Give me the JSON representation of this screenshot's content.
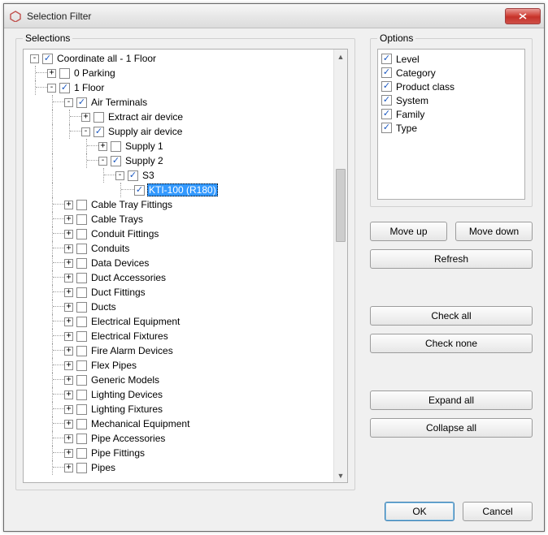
{
  "window": {
    "title": "Selection Filter"
  },
  "selections": {
    "legend": "Selections",
    "tree": {
      "root": {
        "label": "Coordinate all - 1 Floor",
        "checked": true,
        "expand": "-"
      },
      "l0": [
        {
          "label": "0 Parking",
          "checked": false,
          "expand": "+"
        },
        {
          "label": "1 Floor",
          "checked": true,
          "expand": "-"
        }
      ],
      "airterm": {
        "label": "Air Terminals",
        "checked": true,
        "expand": "-"
      },
      "extract": {
        "label": "Extract air device",
        "checked": false,
        "expand": "+"
      },
      "supplydev": {
        "label": "Supply air device",
        "checked": true,
        "expand": "-"
      },
      "supply1": {
        "label": "Supply 1",
        "checked": false,
        "expand": "+"
      },
      "supply2": {
        "label": "Supply 2",
        "checked": true,
        "expand": "-"
      },
      "s3": {
        "label": "S3",
        "checked": true,
        "expand": "-"
      },
      "kti": {
        "label": "KTI-100 (R180)",
        "checked": true
      },
      "siblings": [
        {
          "label": "Cable Tray Fittings",
          "checked": false,
          "expand": "+"
        },
        {
          "label": "Cable Trays",
          "checked": false,
          "expand": "+"
        },
        {
          "label": "Conduit Fittings",
          "checked": false,
          "expand": "+"
        },
        {
          "label": "Conduits",
          "checked": false,
          "expand": "+"
        },
        {
          "label": "Data Devices",
          "checked": false,
          "expand": "+"
        },
        {
          "label": "Duct Accessories",
          "checked": false,
          "expand": "+"
        },
        {
          "label": "Duct Fittings",
          "checked": false,
          "expand": "+"
        },
        {
          "label": "Ducts",
          "checked": false,
          "expand": "+"
        },
        {
          "label": "Electrical Equipment",
          "checked": false,
          "expand": "+"
        },
        {
          "label": "Electrical Fixtures",
          "checked": false,
          "expand": "+"
        },
        {
          "label": "Fire Alarm Devices",
          "checked": false,
          "expand": "+"
        },
        {
          "label": "Flex Pipes",
          "checked": false,
          "expand": "+"
        },
        {
          "label": "Generic Models",
          "checked": false,
          "expand": "+"
        },
        {
          "label": "Lighting Devices",
          "checked": false,
          "expand": "+"
        },
        {
          "label": "Lighting Fixtures",
          "checked": false,
          "expand": "+"
        },
        {
          "label": "Mechanical Equipment",
          "checked": false,
          "expand": "+"
        },
        {
          "label": "Pipe Accessories",
          "checked": false,
          "expand": "+"
        },
        {
          "label": "Pipe Fittings",
          "checked": false,
          "expand": "+"
        },
        {
          "label": "Pipes",
          "checked": false,
          "expand": "+"
        }
      ]
    }
  },
  "options": {
    "legend": "Options",
    "items": [
      {
        "label": "Level",
        "checked": true
      },
      {
        "label": "Category",
        "checked": true
      },
      {
        "label": "Product class",
        "checked": true
      },
      {
        "label": "System",
        "checked": true
      },
      {
        "label": "Family",
        "checked": true
      },
      {
        "label": "Type",
        "checked": true
      }
    ]
  },
  "buttons": {
    "move_up": "Move up",
    "move_down": "Move down",
    "refresh": "Refresh",
    "check_all": "Check all",
    "check_none": "Check none",
    "expand_all": "Expand all",
    "collapse_all": "Collapse all",
    "ok": "OK",
    "cancel": "Cancel"
  }
}
